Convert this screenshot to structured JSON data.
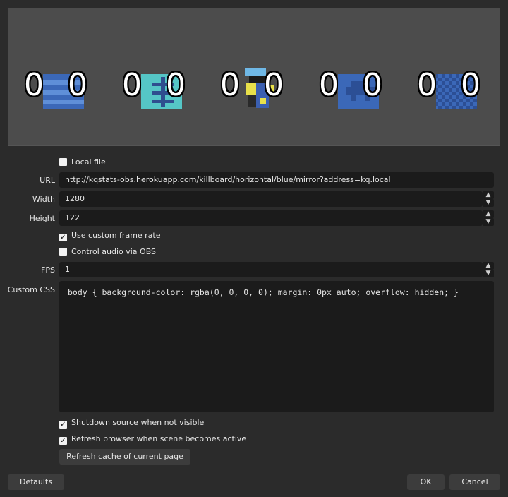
{
  "preview": {
    "scores": [
      {
        "left": "0",
        "right": "0",
        "icon": "blue-stripes-tile"
      },
      {
        "left": "0",
        "right": "0",
        "icon": "teal-glyph-tile"
      },
      {
        "left": "0",
        "right": "0",
        "icon": "pixel-character-icon"
      },
      {
        "left": "0",
        "right": "0",
        "icon": "space-invader-tile"
      },
      {
        "left": "0",
        "right": "0",
        "icon": "checkerboard-tile"
      }
    ]
  },
  "form": {
    "local_file_label": "Local file",
    "url_label": "URL",
    "url_value": "http://kqstats-obs.herokuapp.com/killboard/horizontal/blue/mirror?address=kq.local",
    "width_label": "Width",
    "width_value": "1280",
    "height_label": "Height",
    "height_value": "122",
    "custom_frame_rate_label": "Use custom frame rate",
    "control_audio_label": "Control audio via OBS",
    "fps_label": "FPS",
    "fps_value": "1",
    "custom_css_label": "Custom CSS",
    "custom_css_value": "body { background-color: rgba(0, 0, 0, 0); margin: 0px auto; overflow: hidden; }",
    "shutdown_label": "Shutdown source when not visible",
    "refresh_label": "Refresh browser when scene becomes active",
    "refresh_cache_button": "Refresh cache of current page"
  },
  "checkboxes": {
    "local_file": false,
    "custom_frame_rate": true,
    "control_audio": false,
    "shutdown": true,
    "refresh": true
  },
  "footer": {
    "defaults": "Defaults",
    "ok": "OK",
    "cancel": "Cancel"
  },
  "colors": {
    "background": "#2b2b2b",
    "field": "#1b1b1b",
    "preview": "#4c4c4c",
    "tile_blue": "#3b68b8",
    "tile_teal": "#55c6c6"
  }
}
